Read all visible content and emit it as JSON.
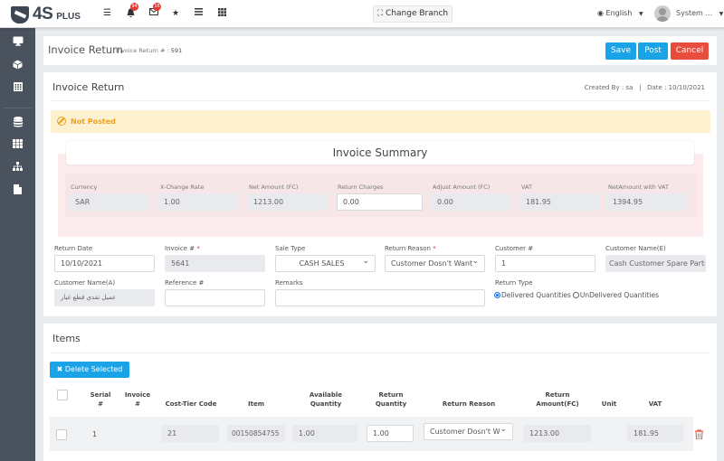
{
  "topbar": {
    "logo_text": "4S",
    "logo_suffix": "PLUS",
    "notifications_count": "94",
    "messages_count": "16",
    "change_branch_label": "Change Branch",
    "language": "English",
    "user_name": "System ..."
  },
  "sidebar": {
    "items": [
      {
        "icon": "monitor-icon"
      },
      {
        "icon": "cube-icon"
      },
      {
        "icon": "calculator-icon"
      },
      {
        "icon": "database-icon"
      },
      {
        "icon": "grid-icon"
      },
      {
        "icon": "sitemap-icon"
      },
      {
        "icon": "file-icon"
      }
    ]
  },
  "page_header": {
    "title": "Invoice Return",
    "sub_label": "Invoice Return # :",
    "sub_value": "591",
    "save_label": "Save",
    "post_label": "Post",
    "cancel_label": "Cancel"
  },
  "card": {
    "title": "Invoice Return",
    "created_by": "Created By : sa",
    "separator": "|",
    "date": "Date : 10/10/2021",
    "status": "Not Posted"
  },
  "summary": {
    "title": "Invoice Summary",
    "fields": [
      {
        "label": "Currency",
        "value": "SAR"
      },
      {
        "label": "X-Change Rate",
        "value": "1.00"
      },
      {
        "label": "Net Amount (FC)",
        "value": "1213.00"
      },
      {
        "label": "Return Charges",
        "value": "0.00"
      },
      {
        "label": "Adjust Amount (FC)",
        "value": "0.00"
      },
      {
        "label": "VAT",
        "value": "181.95"
      },
      {
        "label": "NetAmount with VAT",
        "value": "1394.95"
      }
    ]
  },
  "form": {
    "return_date": {
      "label": "Return Date",
      "value": "10/10/2021"
    },
    "invoice_no": {
      "label": "Invoice # ",
      "required": "*",
      "value": "5641"
    },
    "sale_type": {
      "label": "Sale Type",
      "value": "CASH SALES"
    },
    "return_reason": {
      "label": "Return Reason ",
      "required": "*",
      "value": "Customer Dosn't Want"
    },
    "customer_no": {
      "label": "Customer #",
      "value": "1"
    },
    "customer_name_e": {
      "label": "Customer Name(E)",
      "value": "Cash Customer Spare Parts"
    },
    "customer_name_a": {
      "label": "Customer Name(A)",
      "value": "عميل نقدي قطع غيار"
    },
    "reference_no": {
      "label": "Reference #",
      "value": ""
    },
    "remarks": {
      "label": "Remarks",
      "value": ""
    },
    "return_type": {
      "label": "Return Type",
      "options": [
        "Delivered Quantities",
        "UnDelivered Quantities"
      ],
      "selected": "Delivered Quantities"
    }
  },
  "items": {
    "title": "Items",
    "delete_selected_label": "Delete Selected",
    "columns": [
      {
        "line1": "Serial",
        "line2": "#"
      },
      {
        "line1": "Invoice",
        "line2": "#"
      },
      {
        "line1": "",
        "line2": "Cost-Tier Code"
      },
      {
        "line1": "",
        "line2": "Item"
      },
      {
        "line1": "Available",
        "line2": "Quantity"
      },
      {
        "line1": "Return",
        "line2": "Quantity"
      },
      {
        "line1": "",
        "line2": "Return Reason"
      },
      {
        "line1": "Return",
        "line2": "Amount(FC)"
      },
      {
        "line1": "",
        "line2": "Unit"
      },
      {
        "line1": "",
        "line2": "VAT"
      }
    ],
    "rows": [
      {
        "serial": "1",
        "invoice_no": "",
        "cost_tier_code": "21",
        "item": "00150854755",
        "available_quantity": "1.00",
        "return_quantity": "1.00",
        "return_reason": "Customer Dosn't W",
        "return_amount_fc": "1213.00",
        "unit": "",
        "vat": "181.95"
      }
    ]
  }
}
